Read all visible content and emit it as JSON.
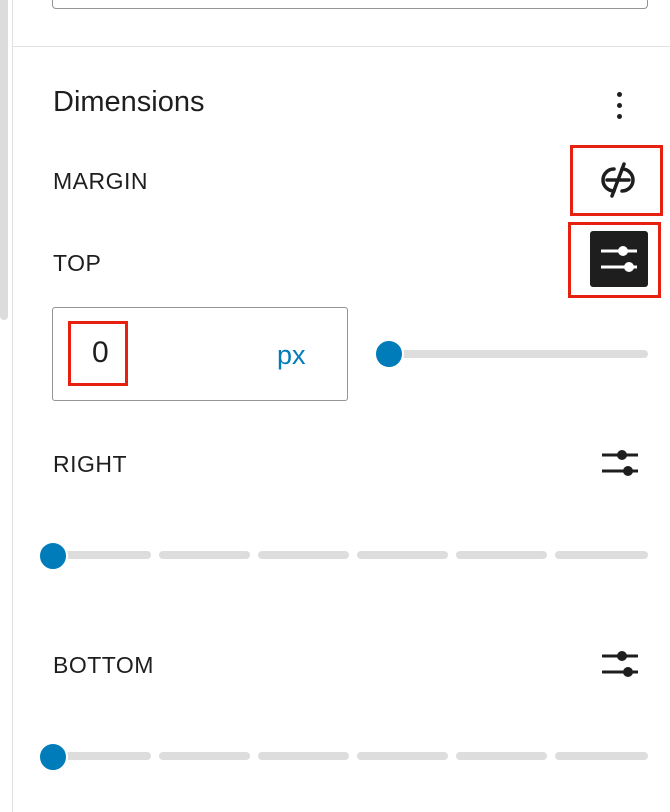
{
  "panel": {
    "title": "Dimensions",
    "more_icon": "more-vertical-icon"
  },
  "margin": {
    "label": "MARGIN",
    "link_icon": "unlink-icon",
    "sides": [
      {
        "label": "TOP",
        "value": "0",
        "unit": "px",
        "slider_value": 0,
        "icon": "custom-settings-icon",
        "icon_active": true
      },
      {
        "label": "RIGHT",
        "slider_value": 0,
        "icon": "custom-settings-icon",
        "icon_active": false
      },
      {
        "label": "BOTTOM",
        "slider_value": 0,
        "icon": "custom-settings-icon",
        "icon_active": false
      }
    ]
  },
  "colors": {
    "accent": "#007cba",
    "highlight": "#e8200f",
    "active_icon_bg": "#1e1e1e"
  }
}
